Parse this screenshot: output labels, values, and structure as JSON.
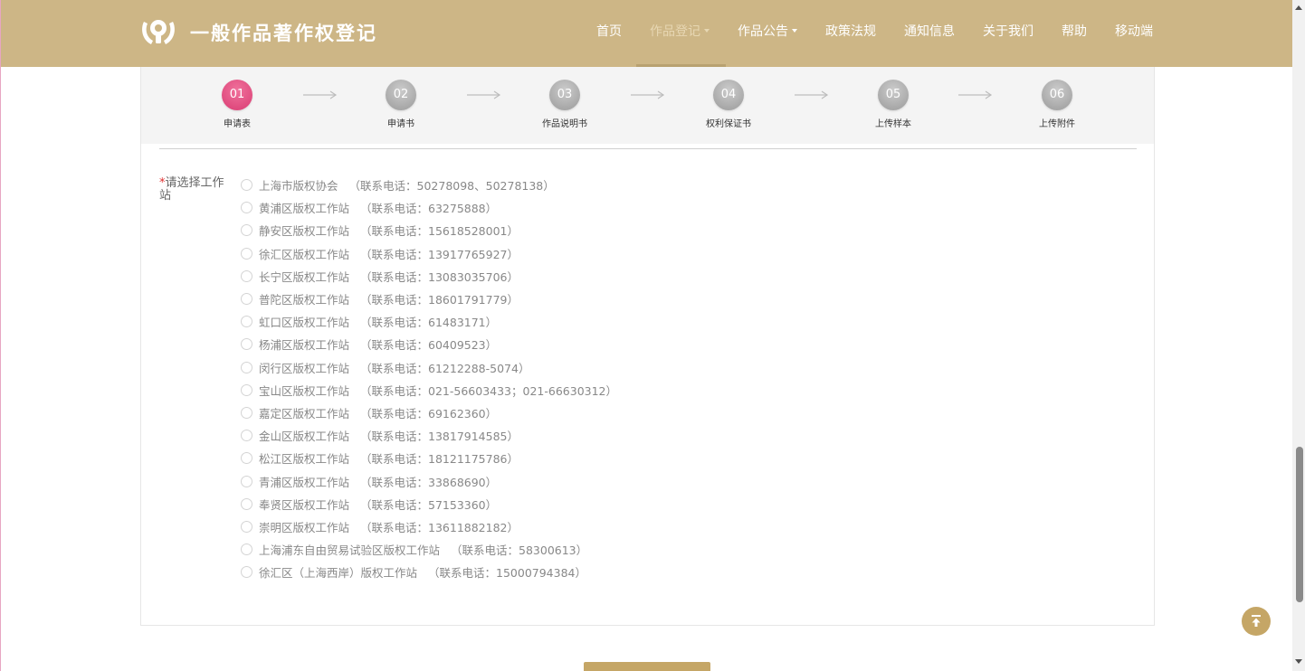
{
  "header": {
    "site_title": "一般作品著作权登记",
    "brand_color": "#cdb686",
    "logo_icon": "hands-bulb-icon",
    "nav": [
      {
        "label": "首页",
        "active": false,
        "has_dropdown": false
      },
      {
        "label": "作品登记",
        "active": true,
        "has_dropdown": true
      },
      {
        "label": "作品公告",
        "active": false,
        "has_dropdown": true
      },
      {
        "label": "政策法规",
        "active": false,
        "has_dropdown": false
      },
      {
        "label": "通知信息",
        "active": false,
        "has_dropdown": false
      },
      {
        "label": "关于我们",
        "active": false,
        "has_dropdown": false
      },
      {
        "label": "帮助",
        "active": false,
        "has_dropdown": false
      },
      {
        "label": "移动端",
        "active": false,
        "has_dropdown": false
      }
    ]
  },
  "steps": {
    "active_color": "#e04c7f",
    "inactive_color": "#a9a9a9",
    "items": [
      {
        "num": "01",
        "label": "申请表",
        "active": true
      },
      {
        "num": "02",
        "label": "申请书",
        "active": false
      },
      {
        "num": "03",
        "label": "作品说明书",
        "active": false
      },
      {
        "num": "04",
        "label": "权利保证书",
        "active": false
      },
      {
        "num": "05",
        "label": "上传样本",
        "active": false
      },
      {
        "num": "06",
        "label": "上传附件",
        "active": false
      }
    ]
  },
  "form": {
    "required_mark": "*",
    "station_label": "请选择工作站",
    "stations": [
      {
        "name": "上海市版权协会",
        "tel": "（联系电话：50278098、50278138）",
        "selected": false
      },
      {
        "name": "黄浦区版权工作站",
        "tel": "（联系电话：63275888）",
        "selected": false
      },
      {
        "name": "静安区版权工作站",
        "tel": "（联系电话：15618528001）",
        "selected": false
      },
      {
        "name": "徐汇区版权工作站",
        "tel": "（联系电话：13917765927）",
        "selected": false
      },
      {
        "name": "长宁区版权工作站",
        "tel": "（联系电话：13083035706）",
        "selected": false
      },
      {
        "name": "普陀区版权工作站",
        "tel": "（联系电话：18601791779）",
        "selected": false
      },
      {
        "name": "虹口区版权工作站",
        "tel": "（联系电话：61483171）",
        "selected": false
      },
      {
        "name": "杨浦区版权工作站",
        "tel": "（联系电话：60409523）",
        "selected": false
      },
      {
        "name": "闵行区版权工作站",
        "tel": "（联系电话：61212288-5074）",
        "selected": false
      },
      {
        "name": "宝山区版权工作站",
        "tel": "（联系电话：021-56603433；021-66630312）",
        "selected": false
      },
      {
        "name": "嘉定区版权工作站",
        "tel": "（联系电话：69162360）",
        "selected": false
      },
      {
        "name": "金山区版权工作站",
        "tel": "（联系电话：13817914585）",
        "selected": false
      },
      {
        "name": "松江区版权工作站",
        "tel": "（联系电话：18121175786）",
        "selected": false
      },
      {
        "name": "青浦区版权工作站",
        "tel": "（联系电话：33868690）",
        "selected": false
      },
      {
        "name": "奉贤区版权工作站",
        "tel": "（联系电话：57153360）",
        "selected": false
      },
      {
        "name": "崇明区版权工作站",
        "tel": "（联系电话：13611882182）",
        "selected": false
      },
      {
        "name": "上海浦东自由贸易试验区版权工作站",
        "tel": "（联系电话：58300613）",
        "selected": false
      },
      {
        "name": "徐汇区（上海西岸）版权工作站",
        "tel": "（联系电话：15000794384）",
        "selected": false
      }
    ]
  },
  "controls": {
    "back_to_top_icon": "arrow-up-to-top-icon",
    "accent_color": "#c5a666"
  }
}
